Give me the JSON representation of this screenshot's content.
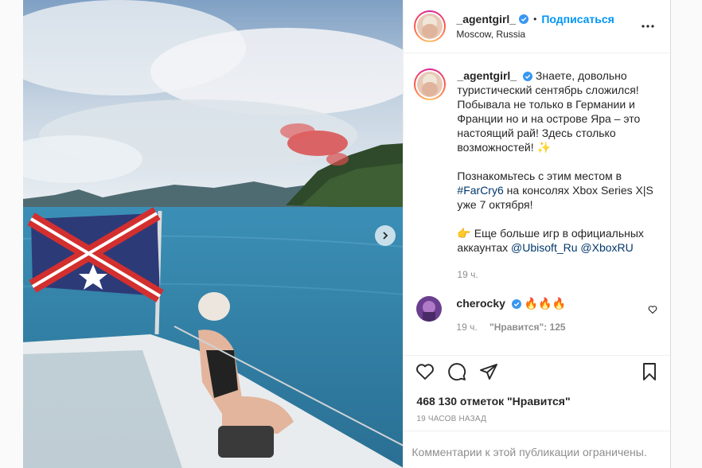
{
  "header": {
    "username": "_agentgirl_",
    "separator": "•",
    "follow_label": "Подписаться",
    "location": "Moscow, Russia",
    "more_icon": "more-horizontal-icon"
  },
  "caption": {
    "username": "_agentgirl_",
    "text1": "Знаете, довольно туристический сентябрь сложился! Побывала не только в Германии и Франции но и на острове Яра – это настоящий рай! Здесь столько возможностей! ✨",
    "text2a": "Познакомьтесь с этим местом в",
    "hashtag": "#FarCry6",
    "text2b": "на консолях Xbox Series X|S уже 7 октября!",
    "text3a": "👉 Еще больше игр в официальных аккаунтах",
    "mention1": "@Ubisoft_Ru",
    "mention2": "@XboxRU",
    "time": "19 ч."
  },
  "comment": {
    "username": "cherocky",
    "text": "🔥🔥🔥",
    "time": "19 ч.",
    "likes": "\"Нравится\": 125"
  },
  "footer": {
    "likes": "468 130 отметок \"Нравится\"",
    "posted": "19 часов назад",
    "comments_limited": "Комментарии к этой публикации ограничены."
  },
  "colors": {
    "accent": "#0095f6",
    "verified": "#3897f0",
    "muted": "#8e8e8e"
  }
}
